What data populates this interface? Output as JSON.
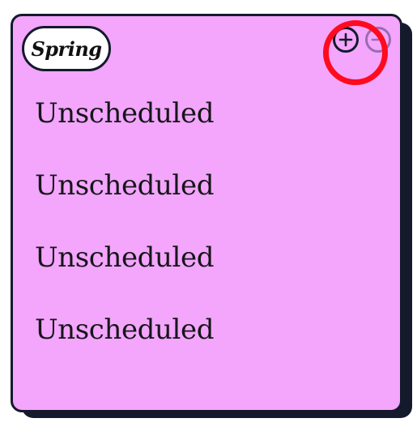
{
  "card": {
    "season_label": "Spring",
    "background_color": "#f3a6fb",
    "border_color": "#141a2c"
  },
  "controls": {
    "add_icon": "plus-circle-icon",
    "remove_icon": "minus-circle-icon",
    "remove_disabled": true,
    "highlight_color": "#ff0a1e"
  },
  "slots": [
    {
      "label": "Unscheduled"
    },
    {
      "label": "Unscheduled"
    },
    {
      "label": "Unscheduled"
    },
    {
      "label": "Unscheduled"
    }
  ]
}
